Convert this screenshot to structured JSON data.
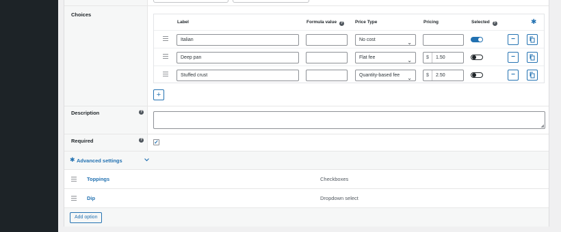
{
  "choices": {
    "section_label": "Choices",
    "headers": {
      "label": "Label",
      "formula": "Formula value",
      "price_type": "Price Type",
      "pricing": "Pricing",
      "selected": "Selected"
    },
    "rows": [
      {
        "label": "Italian",
        "formula": "",
        "price_type": "No cost",
        "currency": "",
        "price": "",
        "selected": true
      },
      {
        "label": "Deep pan",
        "formula": "",
        "price_type": "Flat fee",
        "currency": "$",
        "price": "1.50",
        "selected": false
      },
      {
        "label": "Stuffed crust",
        "formula": "",
        "price_type": "Quantity-based fee",
        "currency": "$",
        "price": "2.50",
        "selected": false
      }
    ],
    "add_symbol": "+"
  },
  "description": {
    "label": "Description",
    "value": ""
  },
  "required": {
    "label": "Required",
    "checked": true
  },
  "advanced": {
    "label": "Advanced settings"
  },
  "options": [
    {
      "name": "Toppings",
      "type": "Checkboxes"
    },
    {
      "name": "Dip",
      "type": "Dropdown select"
    }
  ],
  "footer": {
    "add_option_label": "Add option"
  },
  "icons": {
    "help": "question-circle-icon",
    "drag": "drag-handle-icon",
    "gear": "gear-icon",
    "remove": "minus-icon",
    "duplicate": "copy-icon",
    "chevron": "chevron-down-icon"
  },
  "colors": {
    "accent": "#2271b1",
    "adminbar": "#1d2327"
  }
}
